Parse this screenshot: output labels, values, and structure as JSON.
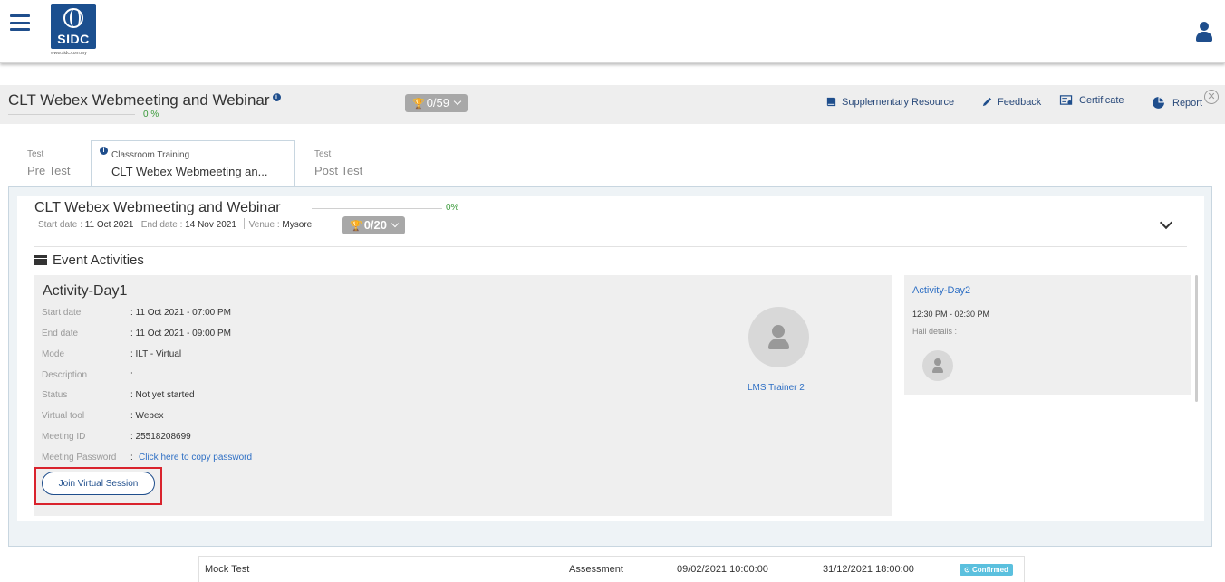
{
  "brand": {
    "logo_text": "SIDC",
    "logo_url": "www.sidc.com.my"
  },
  "course": {
    "title": "CLT Webex Webmeeting and Webinar",
    "progress_pct": "0 %",
    "trophy": "0/59",
    "links": [
      {
        "label": "Supplementary Resource",
        "icon": "book-icon"
      },
      {
        "label": "Feedback",
        "icon": "pencil-icon"
      },
      {
        "label": "Certificate",
        "icon": "certificate-icon"
      },
      {
        "label": "Report",
        "icon": "pie-chart-icon"
      }
    ]
  },
  "tabs": [
    {
      "small": "Test",
      "big": "Pre Test"
    },
    {
      "small": "Classroom Training",
      "big": "CLT Webex Webmeeting an..."
    },
    {
      "small": "Test",
      "big": "Post Test"
    }
  ],
  "event": {
    "title": "CLT Webex Webmeeting and Webinar",
    "progress_pct": "0%",
    "start_label": "Start date :",
    "start_value": "11 Oct 2021",
    "end_label": "End date :",
    "end_value": "14 Nov 2021",
    "venue_label": "Venue :",
    "venue_value": "Mysore",
    "trophy": "0/20"
  },
  "section_title": "Event Activities",
  "activity1": {
    "name": "Activity-Day1",
    "rows": [
      {
        "label": "Start date",
        "value": ": 11 Oct 2021 - 07:00 PM"
      },
      {
        "label": "End date",
        "value": ": 11 Oct 2021 - 09:00 PM"
      },
      {
        "label": "Mode",
        "value": ": ILT - Virtual"
      },
      {
        "label": "Description",
        "value": ":"
      },
      {
        "label": "Status",
        "value": ": Not yet started"
      },
      {
        "label": "Virtual tool",
        "value": ":  Webex"
      },
      {
        "label": "Meeting ID",
        "value": ": 25518208699"
      }
    ],
    "password_label": "Meeting Password",
    "password_colon": ":",
    "password_link": "Click here to copy password",
    "join_label": "Join Virtual Session",
    "trainer": "LMS Trainer 2"
  },
  "activity2": {
    "name": "Activity-Day2",
    "time": "12:30 PM - 02:30 PM",
    "hall": "Hall details :"
  },
  "bottom_row": {
    "name": "Mock Test",
    "type": "Assessment",
    "start": "09/02/2021 10:00:00",
    "end": "31/12/2021 18:00:00",
    "status": "Confirmed"
  },
  "colors": {
    "brand": "#1f4e8c",
    "link": "#2e6fc4",
    "highlight": "#d9232d",
    "success": "#3a9a3a",
    "badge": "#5bc0de"
  }
}
